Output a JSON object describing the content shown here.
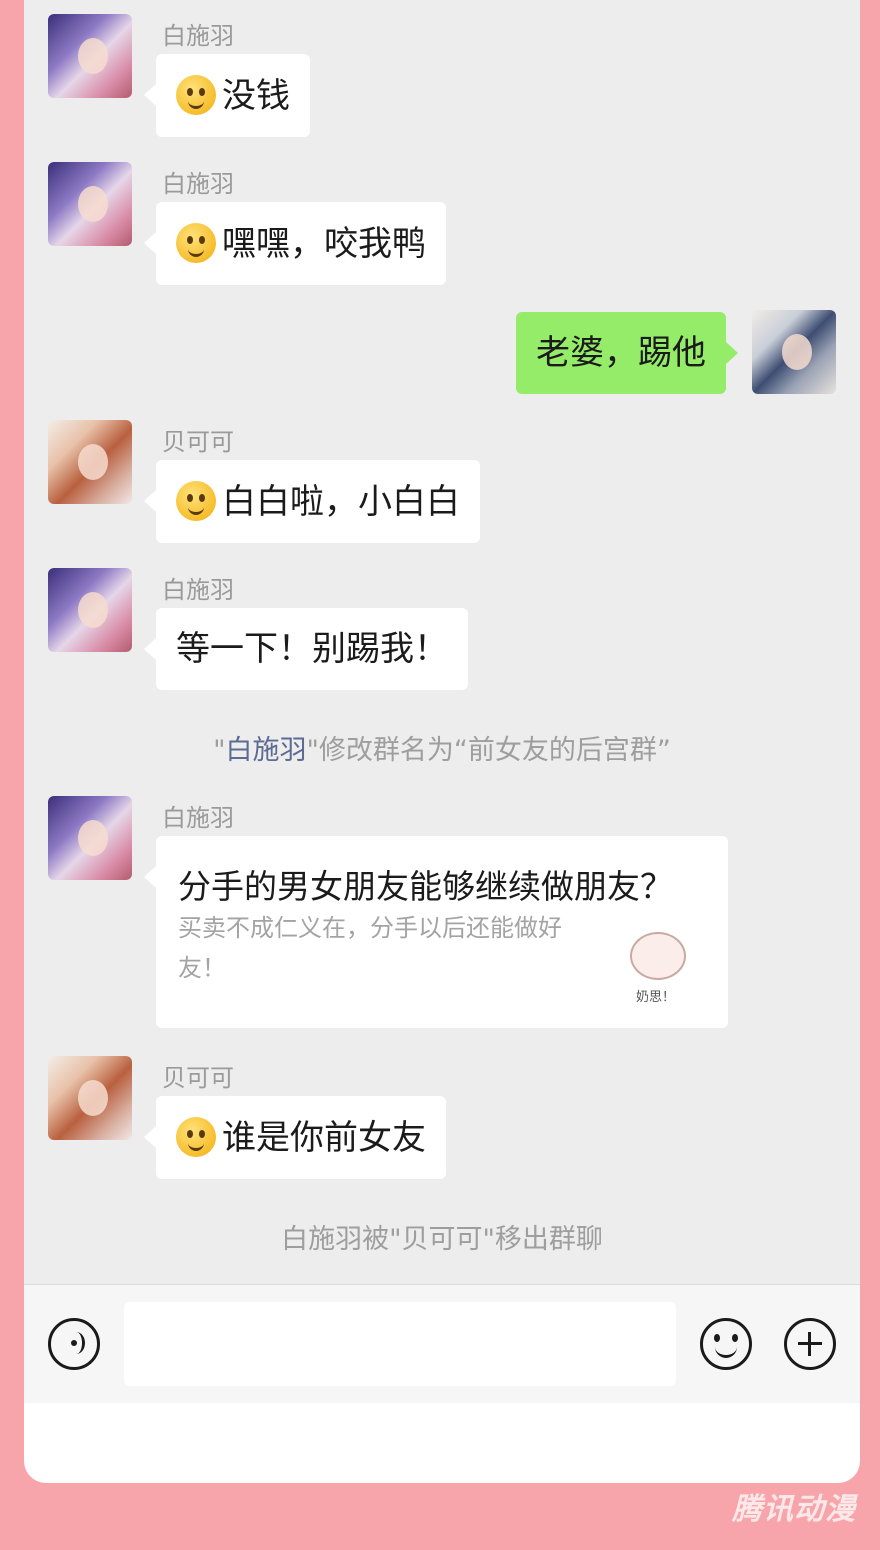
{
  "messages": [
    {
      "sender": "白施羽",
      "text": "没钱",
      "emoji": "smirk-emoji"
    },
    {
      "sender": "白施羽",
      "text": "嘿嘿，咬我鸭",
      "emoji": "grin-emoji"
    },
    {
      "sender": "",
      "text": "老婆，踢他"
    },
    {
      "sender": "贝可可",
      "text": "白白啦，小白白",
      "emoji": "facepalm-emoji"
    },
    {
      "sender": "白施羽",
      "text": "等一下！别踢我！"
    }
  ],
  "system_rename": {
    "open_quote": "\"",
    "name": "白施羽",
    "rest": "\"修改群名为“前女友的后宫群”"
  },
  "card_message": {
    "sender": "白施羽",
    "title": "分手的男女朋友能够继续做朋友？",
    "description": "买卖不成仁义在，分手以后还能做好友！",
    "thumb_text": "奶思！"
  },
  "last_message": {
    "sender": "贝可可",
    "text": "谁是你前女友",
    "emoji": "smile-emoji"
  },
  "system_removed": "白施羽被\"贝可可\"移出群聊",
  "watermark": "腾讯动漫",
  "colors": {
    "outer": "#f7a4aa",
    "chat_bg": "#ededed",
    "sent_bubble": "#95ec69"
  }
}
